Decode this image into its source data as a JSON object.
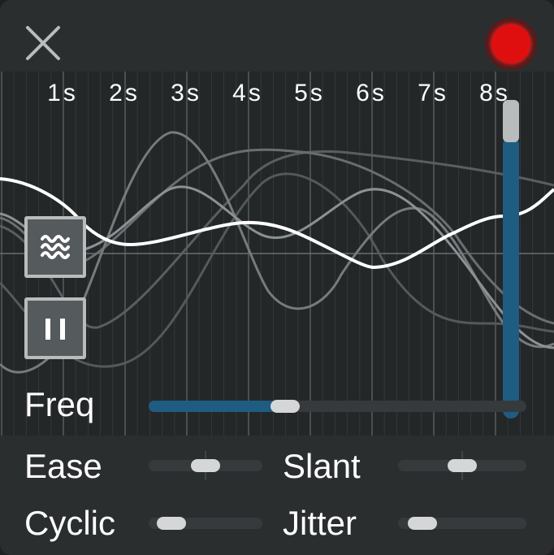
{
  "header": {
    "close_icon": "close-x-icon",
    "record_icon": "record-dot-icon",
    "record_color": "#e00f0f"
  },
  "timeline": {
    "ticks": [
      "1s",
      "2s",
      "3s",
      "4s",
      "5s",
      "6s",
      "7s",
      "8s"
    ]
  },
  "side_buttons": {
    "wave_icon": "wave-icon",
    "pause_icon": "pause-icon"
  },
  "position_slider": {
    "value": 1.0
  },
  "freq": {
    "label": "Freq",
    "value": 0.35
  },
  "ease": {
    "label": "Ease",
    "value": 0.5
  },
  "slant": {
    "label": "Slant",
    "value": 0.5
  },
  "cyclic": {
    "label": "Cyclic",
    "value": 0.1
  },
  "jitter": {
    "label": "Jitter",
    "value": 0.1
  },
  "colors": {
    "accent": "#1f5c82",
    "active_curve": "#ffffff",
    "background": "#2b2e2f"
  }
}
